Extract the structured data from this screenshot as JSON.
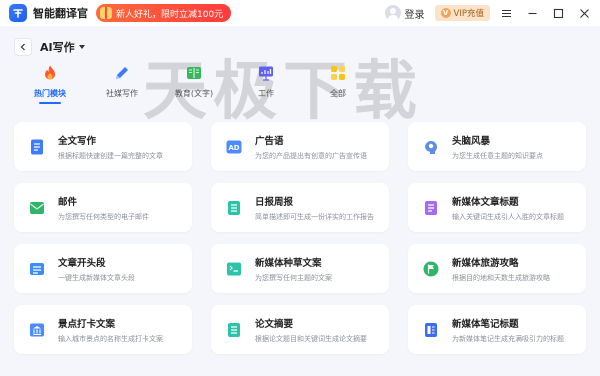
{
  "titlebar": {
    "app_name": "智能翻译官",
    "promo": "新人好礼，限时立减100元",
    "login": "登录",
    "vip": "VIP充值",
    "vip_badge": "V"
  },
  "header": {
    "title": "AI写作"
  },
  "tabs": [
    {
      "label": "热门模块",
      "icon": "flame-icon",
      "active": true
    },
    {
      "label": "社媒写作",
      "icon": "pen-icon",
      "active": false
    },
    {
      "label": "教育(文字)",
      "icon": "book-icon",
      "active": false
    },
    {
      "label": "工作",
      "icon": "chart-board-icon",
      "active": false
    },
    {
      "label": "全部",
      "icon": "grid-icon",
      "active": false
    }
  ],
  "watermark": "天极下载",
  "cards": [
    {
      "title": "全文写作",
      "desc": "根据标题快速创建一篇完整的文章",
      "icon": "document-icon",
      "color": "#3d7cff"
    },
    {
      "title": "广告语",
      "desc": "为您的产品提出有创意的广告宣传语",
      "icon": "ad-icon",
      "color": "#4a8bff"
    },
    {
      "title": "头脑风暴",
      "desc": "为您生成任意主题的知识要点",
      "icon": "brain-icon",
      "color": "#5d8fe8"
    },
    {
      "title": "邮件",
      "desc": "为您撰写任何类型的电子邮件",
      "icon": "mail-icon",
      "color": "#2fb56a"
    },
    {
      "title": "日报周报",
      "desc": "简单描述即可生成一份详实的工作报告",
      "icon": "report-icon",
      "color": "#2cc4a8"
    },
    {
      "title": "新媒体文章标题",
      "desc": "输入关键词生成引人入胜的文章标题",
      "icon": "headline-icon",
      "color": "#a56cf0"
    },
    {
      "title": "文章开头段",
      "desc": "一键生成新媒体文章头段",
      "icon": "paragraph-icon",
      "color": "#3a8cff"
    },
    {
      "title": "新媒体种草文案",
      "desc": "为您撰写任何主题的文案",
      "icon": "seed-icon",
      "color": "#2cc4a8"
    },
    {
      "title": "新媒体旅游攻略",
      "desc": "根据目的地和天数生成旅游攻略",
      "icon": "flag-icon",
      "color": "#2fb56a"
    },
    {
      "title": "景点打卡文案",
      "desc": "输入城市景点的名称生成打卡文案",
      "icon": "landmark-icon",
      "color": "#4a8bff"
    },
    {
      "title": "论文摘要",
      "desc": "根据论文题目和关键词生成论文摘要",
      "icon": "abstract-icon",
      "color": "#2cc4a8"
    },
    {
      "title": "新媒体笔记标题",
      "desc": "为新媒体笔记生成充满吸引力的标题",
      "icon": "note-icon",
      "color": "#3d6cf0"
    }
  ]
}
